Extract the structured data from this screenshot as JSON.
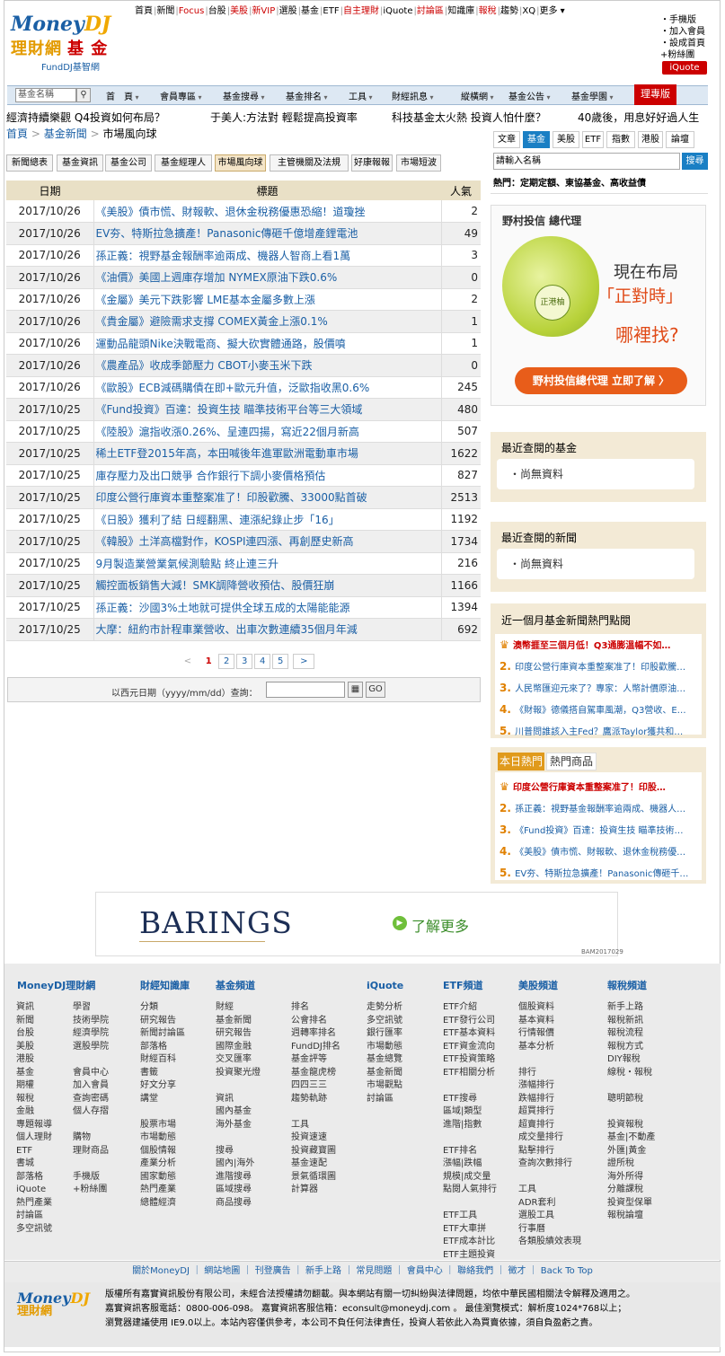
{
  "topnav": [
    {
      "label": "首頁",
      "c": ""
    },
    {
      "label": "新聞",
      "c": ""
    },
    {
      "label": "Focus",
      "c": "red"
    },
    {
      "label": "台股",
      "c": ""
    },
    {
      "label": "美股",
      "c": "red"
    },
    {
      "label": "新VIP",
      "c": "red"
    },
    {
      "label": "選股",
      "c": ""
    },
    {
      "label": "基金",
      "c": ""
    },
    {
      "label": "ETF",
      "c": ""
    },
    {
      "label": "自主理財",
      "c": "red"
    },
    {
      "label": "iQuote",
      "c": ""
    },
    {
      "label": "討論區",
      "c": "red"
    },
    {
      "label": "知識庫",
      "c": ""
    },
    {
      "label": "報稅",
      "c": "red"
    },
    {
      "label": "趨勢",
      "c": ""
    },
    {
      "label": "XQ",
      "c": ""
    },
    {
      "label": "更多 ▾",
      "c": ""
    }
  ],
  "logo": {
    "brand_money": "Money",
    "brand_dj": "DJ",
    "sub": "理財網",
    "sub_fund": "基 金",
    "fdj": "FundDJ基智網"
  },
  "right_links": [
    "・手機版",
    "・加入會員",
    "・設成首頁",
    "+粉絲團"
  ],
  "iquote_label": "iQuote",
  "mainnav": {
    "search_placeholder": "基金名稱",
    "items": [
      "首　頁",
      "會員專區",
      "基金搜尋",
      "基金排名",
      "工具",
      "財經訊息",
      "縱橫網",
      "基金公告",
      "基金學園"
    ],
    "money_label": "理專版"
  },
  "tickers": [
    "經濟持續樂觀 Q4投資如何布局？",
    "于美人:方法對 輕鬆提高投資率",
    "科技基金太火熱 投資人怕什麼？",
    "40歲後，用息好好過人生"
  ],
  "breadcrumb": {
    "home": "首頁",
    "sep": ">",
    "news": "基金新聞",
    "current": "市場風向球"
  },
  "tabs": [
    "新聞總表",
    "基金資訊",
    "基金公司",
    "基金經理人",
    "市場風向球",
    "主管機關及法規",
    "好康報報",
    "市場短波"
  ],
  "active_tab": 4,
  "table": {
    "headers": [
      "日期",
      "標題",
      "人氣"
    ],
    "rows": [
      [
        "2017/10/26",
        "《美股》債市慌、財報軟、退休金稅務優惠恐縮！道瓊挫",
        "2"
      ],
      [
        "2017/10/26",
        "EV夯、特斯拉急擴產！Panasonic傳砸千億增產鋰電池",
        "49"
      ],
      [
        "2017/10/26",
        "孫正義：視野基金報酬率逾兩成、機器人智商上看1萬",
        "3"
      ],
      [
        "2017/10/26",
        "《油價》美國上週庫存增加 NYMEX原油下跌0.6%",
        "0"
      ],
      [
        "2017/10/26",
        "《金屬》美元下跌影響 LME基本金屬多數上漲",
        "2"
      ],
      [
        "2017/10/26",
        "《貴金屬》避險需求支撐 COMEX黃金上漲0.1%",
        "1"
      ],
      [
        "2017/10/26",
        "運動品龍頭Nike決戰電商、擬大砍實體通路，股價噴",
        "1"
      ],
      [
        "2017/10/26",
        "《農產品》收成季節壓力 CBOT小麥玉米下跌",
        "0"
      ],
      [
        "2017/10/26",
        "《歐股》ECB減碼購債在即+歐元升值，泛歐指收黑0.6%",
        "245"
      ],
      [
        "2017/10/25",
        "《Fund投資》百達：投資生技 瞄準技術平台等三大領域",
        "480"
      ],
      [
        "2017/10/25",
        "《陸股》滬指收漲0.26%、呈連四揚，寫近22個月新高",
        "507"
      ],
      [
        "2017/10/25",
        "稀土ETF登2015年高，本田喊後年進軍歐洲電動車市場",
        "1622"
      ],
      [
        "2017/10/25",
        "庫存壓力及出口競爭 合作銀行下調小麥價格預估",
        "827"
      ],
      [
        "2017/10/25",
        "印度公營行庫資本重整案准了！印股歡騰、33000點首破",
        "2513"
      ],
      [
        "2017/10/25",
        "《日股》獲利了結 日經翻黑、連漲紀錄止步「16」",
        "1192"
      ],
      [
        "2017/10/25",
        "《韓股》土洋高檔對作，KOSPI連四漲、再創歷史新高",
        "1734"
      ],
      [
        "2017/10/25",
        "9月製造業營業氣候測驗點 終止連三升",
        "216"
      ],
      [
        "2017/10/25",
        "觸控面板銷售大減！SMK調降營收預估、股價狂崩",
        "1166"
      ],
      [
        "2017/10/25",
        "孫正義：沙國3%土地就可提供全球五成的太陽能能源",
        "1394"
      ],
      [
        "2017/10/25",
        "大摩：紐約市計程車業營收、出車次數連續35個月年減",
        "692"
      ]
    ]
  },
  "pager": {
    "prev": "<",
    "pages": [
      "1",
      "2",
      "3",
      "4",
      "5"
    ],
    "next": ">"
  },
  "datebar": {
    "label": "以西元日期（yyyy/mm/dd）查詢：",
    "go": "GO"
  },
  "rtabs": [
    "文章",
    "基金",
    "美股",
    "ETF",
    "指數",
    "港股",
    "論壇"
  ],
  "rsearch": {
    "placeholder": "請輸入名稱",
    "button": "搜尋"
  },
  "hot_line": "熱門：定期定額、東協基金、高收益債",
  "ad1": {
    "title": "野村投信 總代理",
    "line1": "現在布局",
    "line2": "「正對時」",
    "line3": "哪裡找?",
    "badge": "正港柚",
    "cta": "野村投信總代理 立即了解 〉"
  },
  "recent_funds": {
    "title": "最近查閱的基金",
    "empty": "尚無資料"
  },
  "recent_news": {
    "title": "最近查閱的新聞",
    "empty": "尚無資料"
  },
  "hot_month": {
    "title": "近一個月基金新聞熱門點閱",
    "items": [
      "澳幣捱至三個月低！Q3通膨溫幅不如…",
      "印度公營行庫資本重整案准了！印股歡騰…",
      "人民幣匯迎元來了？專家：人幣計價原油…",
      "《財報》德儀搭自駕車風潮，Q3營收、E…",
      "川普問誰該入主Fed？鷹派Taylor獲共和…"
    ]
  },
  "hot_today": {
    "tab1": "本日熱門",
    "tab2": "熱門商品",
    "items": [
      "印度公營行庫資本重整案准了！印股…",
      "孫正義：視野基金報酬率逾兩成、機器人…",
      "《Fund投資》百達：投資生技 瞄準技術…",
      "《美股》債市慌、財報軟、退休金稅務優…",
      "EV夯、特斯拉急擴產！Panasonic傳砸千…"
    ]
  },
  "ad2": {
    "brand": "BARINGS",
    "cta": "了解更多",
    "code": "BAM2017029"
  },
  "footer": {
    "headers": [
      "MoneyDJ理財網",
      "財經知識庫",
      "基金頻道",
      "iQuote",
      "ETF頻道",
      "美股頻道",
      "報稅頻道"
    ],
    "cols": [
      "資訊\n新聞\n台股\n美股\n港股\n基金\n期權\n報稅\n金融\n專題報導\n個人理財\nETF\n書城\n部落格\niQuote\n熱門產業\n討論區\n多空訊號",
      "學習\n技術學院\n經濟學院\n選股學院\n\n會員中心\n加入會員\n查詢密碼\n個人存摺\n\n購物\n理財商品\n\n手機版\n+粉絲團",
      "分類\n研究報告\n新聞討論區\n部落格\n財經百科\n書籤\n好文分享\n講堂\n\n股票市場\n市場動態\n個股情報\n產業分析\n國家動態\n熱門產業\n總體經濟",
      "財經\n基金新聞\n研究報告\n國際金融\n交叉匯率\n投資聚光燈\n\n資訊\n國內基金\n海外基金\n\n搜尋\n國內|海外\n進階搜尋\n區域搜尋\n商品搜尋",
      "排名\n公會排名\n週轉率排名\nFundDJ排名\n基金評等\n基金龍虎榜\n四四三三\n趨勢軌跡\n\n工具\n投資速速\n投資藏寶圖\n基金速配\n景氣循環圖\n計算器",
      "走勢分析\n多空訊號\n銀行匯率\n市場動態\n基金總覽\n基金新聞\n市場觀點\n討論區",
      "ETF介紹\nETF發行公司\nETF基本資料\nETF資金流向\nETF投資策略\nETF相關分析\n\nETF搜尋\n區域|類型\n進階|指數\n\nETF排名\n漲幅|跌幅\n規模|成交量\n點閱人氣排行\n\nETF工具\nETF大車拼\nETF成本計比\nETF主題投資",
      "個股資料\n基本資料\n行情報價\n基本分析\n\n排行\n漲幅排行\n跌幅排行\n超買排行\n超賣排行\n成交量排行\n點擊排行\n查詢次數排行\n\n工具\nADR套利\n選股工具\n行事曆\n各類股績效表現",
      "新手上路\n報稅新訊\n報稅流程\n報稅方式\nDIY報稅\n線稅・報稅\n\n聰明節稅\n\n投資報稅\n基金|不動產\n外匯|黃金\n證所稅\n海外所得\n分離課稅\n投資型保單\n報稅論壇"
    ]
  },
  "footer_links": "關於MoneyDJ ｜ 網站地圖 ｜ 刊登廣告 ｜ 新手上路 ｜ 常見問題 ｜ 會員中心 ｜ 聯絡我們 ｜ 徵才 ｜ Back To Top",
  "copyright": {
    "line1": "版權所有嘉實資訊股份有限公司，未經合法授權請勿翻載。與本網站有關一切糾紛與法律問題，均依中華民國相關法令解釋及適用之。",
    "line2": "嘉實資訊客服電話：0800-006-098。 嘉實資訊客服信箱：econsult@moneydj.com 。 最佳瀏覽模式：解析度1024*768以上；",
    "line3": "瀏覽器建議使用 IE9.0以上。本站內容僅供參考，本公司不負任何法律責任，投資人若依此入為買賣依據，須自負盈虧之責。"
  },
  "colors": {
    "accent": "#1a5fa5",
    "brand_red": "#cc0000",
    "table_head": "#e9e0c6",
    "side_box": "#f3ead6"
  }
}
